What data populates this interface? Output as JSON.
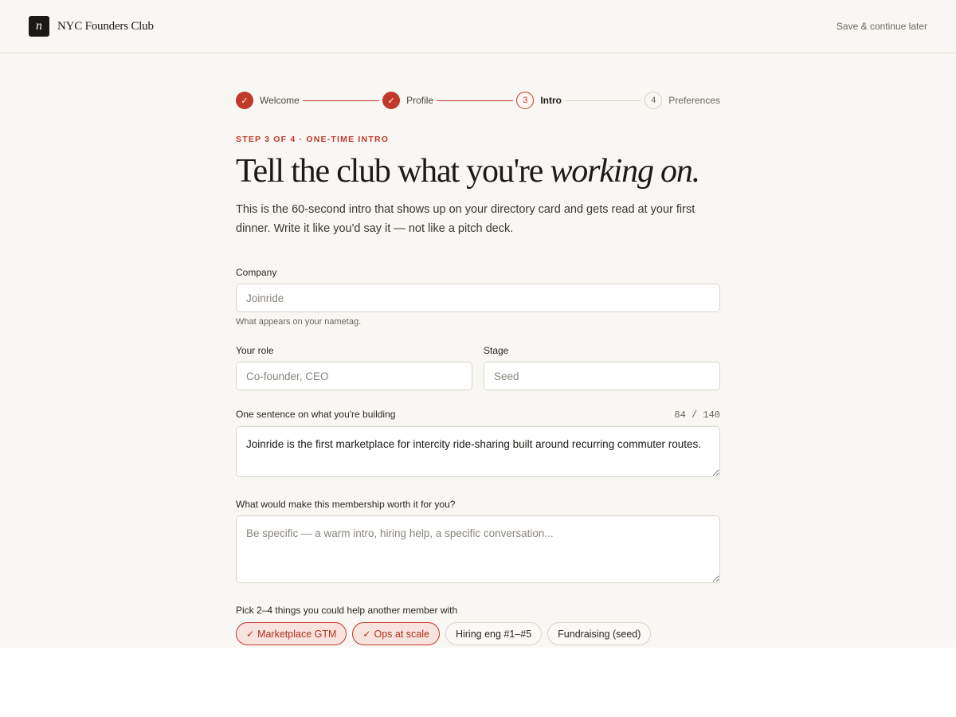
{
  "header": {
    "logo_letter": "n",
    "brand": "NYC Founders Club",
    "save_later": "Save & continue later"
  },
  "stepper": {
    "steps": [
      {
        "label": "Welcome",
        "state": "done",
        "number": "1"
      },
      {
        "label": "Profile",
        "state": "done",
        "number": "2"
      },
      {
        "label": "Intro",
        "state": "current",
        "number": "3"
      },
      {
        "label": "Preferences",
        "state": "todo",
        "number": "4"
      }
    ],
    "check_glyph": "✓"
  },
  "intro": {
    "eyebrow": "Step 3 of 4 · One-time intro",
    "title_main": "Tell the club what you're ",
    "title_emph": "working on.",
    "lede": "This is the 60-second intro that shows up on your directory card and gets read at your first dinner. Write it like you'd say it — not like a pitch deck."
  },
  "form": {
    "company": {
      "label": "Company",
      "placeholder": "Joinride",
      "value": "",
      "hint": "What appears on your nametag."
    },
    "role": {
      "label": "Your role",
      "placeholder": "Co-founder, CEO",
      "value": ""
    },
    "stage": {
      "label": "Stage",
      "placeholder": "Seed",
      "value": ""
    },
    "sentence": {
      "label": "One sentence on what you're building",
      "counter": "84 / 140",
      "value": "Joinride is the first marketplace for intercity ride-sharing built around recurring commuter routes."
    },
    "worth": {
      "label": "What would make this membership worth it for you?",
      "placeholder": "Be specific — a warm intro, hiring help, a specific conversation...",
      "value": ""
    },
    "help": {
      "label": "Pick 2–4 things you could help another member with",
      "chips": [
        {
          "label": "Marketplace GTM",
          "selected": true
        },
        {
          "label": "Ops at scale",
          "selected": true
        },
        {
          "label": "Hiring eng #1–#5",
          "selected": false
        },
        {
          "label": "Fundraising (seed)",
          "selected": false
        }
      ]
    }
  },
  "colors": {
    "accent": "#c0392b",
    "background": "#f9f7f3",
    "chip_selected_bg": "#f8e3de"
  }
}
